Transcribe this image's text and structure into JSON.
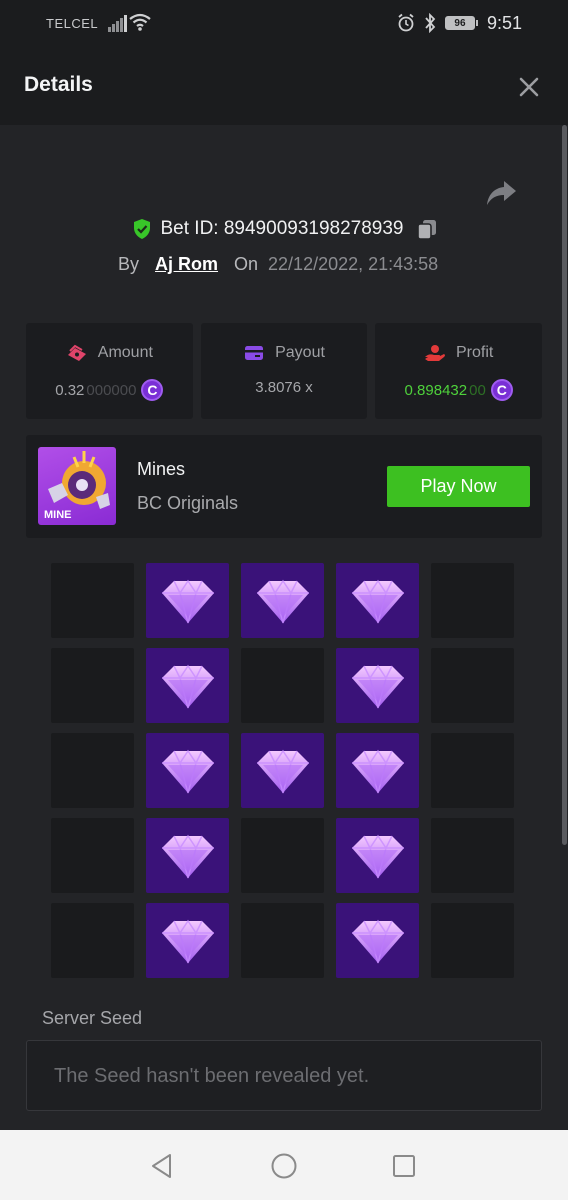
{
  "status_bar": {
    "carrier": "TELCEL",
    "battery": "96",
    "time": "9:51",
    "icons": [
      "signal-icon",
      "wifi-icon",
      "alarm-icon",
      "bluetooth-icon",
      "battery-icon"
    ]
  },
  "header": {
    "title": "Details",
    "close_icon": "close-icon"
  },
  "bet": {
    "id_text": "Bet ID: 89490093198278939",
    "by_label": "By",
    "username": "Aj Rom",
    "on_label": "On",
    "datetime": "22/12/2022, 21:43:58"
  },
  "stats": {
    "amount": {
      "label": "Amount",
      "value_main": "0.32",
      "value_dim": "000000"
    },
    "payout": {
      "label": "Payout",
      "value": "3.8076 x"
    },
    "profit": {
      "label": "Profit",
      "value_main": "0.898432",
      "value_dim": "00"
    },
    "coin_symbol": "C"
  },
  "game": {
    "name": "Mines",
    "provider": "BC Originals",
    "thumb_label": "MINE",
    "play_label": "Play Now"
  },
  "board": {
    "rows": 5,
    "cols": 5,
    "cells": [
      [
        0,
        1,
        1,
        1,
        0
      ],
      [
        0,
        1,
        0,
        1,
        0
      ],
      [
        0,
        1,
        1,
        1,
        0
      ],
      [
        0,
        1,
        0,
        1,
        0
      ],
      [
        0,
        1,
        0,
        1,
        0
      ]
    ]
  },
  "server_seed": {
    "label": "Server Seed",
    "value": "The Seed hasn't been revealed yet."
  },
  "colors": {
    "accent_green": "#3dc021",
    "gem_tile": "#3a1279",
    "background": "#232427"
  }
}
